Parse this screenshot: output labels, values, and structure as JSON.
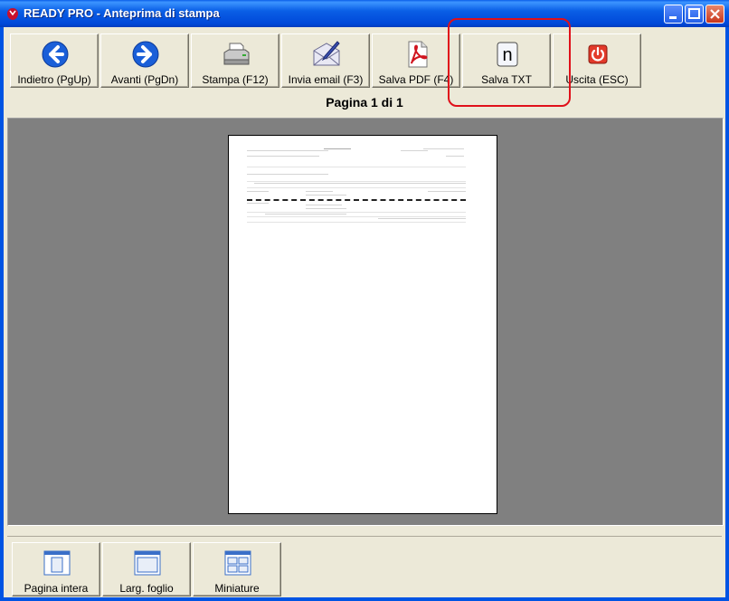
{
  "window": {
    "title": "READY PRO - Anteprima di stampa"
  },
  "toolbar": {
    "back_label": "Indietro (PgUp)",
    "forward_label": "Avanti (PgDn)",
    "print_label": "Stampa (F12)",
    "email_label": "Invia email (F3)",
    "pdf_label": "Salva PDF (F4)",
    "txt_label": "Salva TXT",
    "txt_icon_letter": "n",
    "exit_label": "Uscita (ESC)"
  },
  "page_indicator": "Pagina 1 di 1",
  "view_buttons": {
    "full_page_label": "Pagina intera",
    "page_width_label": "Larg. foglio",
    "thumbnails_label": "Miniature"
  },
  "icons": {
    "back": "arrow-left-icon",
    "forward": "arrow-right-icon",
    "print": "printer-icon",
    "email": "envelope-pen-icon",
    "pdf": "pdf-document-icon",
    "txt": "text-file-icon",
    "exit": "power-icon"
  },
  "colors": {
    "highlight": "#e0101a",
    "titlebar": "#0054e3",
    "preview_bg": "#808080"
  }
}
